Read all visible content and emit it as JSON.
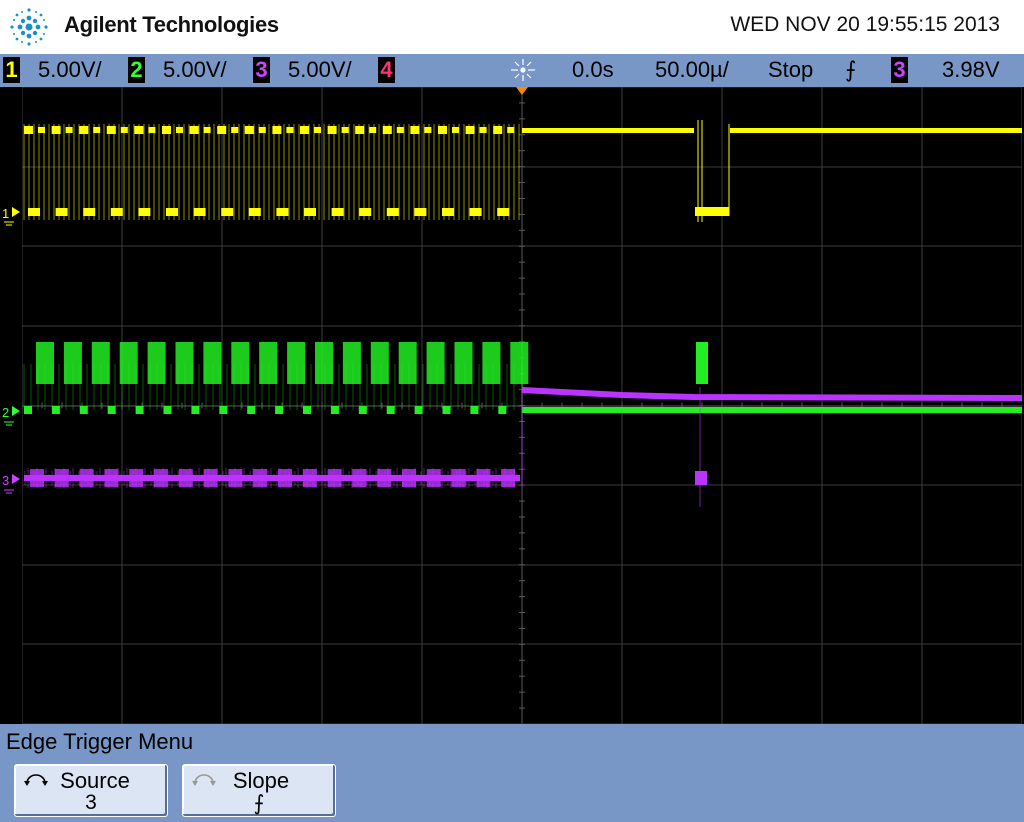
{
  "header": {
    "brand": "Agilent Technologies",
    "datetime": "WED NOV 20 19:55:15 2013"
  },
  "status_bar": {
    "channels": [
      {
        "number": "1",
        "scale": "5.00V/",
        "color": "#ffff00"
      },
      {
        "number": "2",
        "scale": "5.00V/",
        "color": "#33ff33"
      },
      {
        "number": "3",
        "scale": "5.00V/",
        "color": "#cc44ff"
      },
      {
        "number": "4",
        "scale": "",
        "color": "#ff3377"
      }
    ],
    "time_delay": "0.0s",
    "time_scale": "50.00µ/",
    "run_state": "Stop",
    "trigger_slope_symbol": "⨍",
    "trigger_source": "3",
    "trigger_level": "3.98V"
  },
  "display": {
    "markers": [
      {
        "label": "1",
        "color": "#ffff00"
      },
      {
        "label": "2",
        "color": "#33ff33"
      },
      {
        "label": "3",
        "color": "#cc44ff"
      }
    ],
    "grid": true,
    "trace_colors": {
      "ch1": "#ffff00",
      "ch2": "#22ee22",
      "ch3": "#bb33ff"
    }
  },
  "menu": {
    "title": "Edge Trigger Menu",
    "softkeys": [
      {
        "label": "Source",
        "value": "3",
        "icon": "rotary-knob-icon"
      },
      {
        "label": "Slope",
        "value": "⨍",
        "icon": "rotary-knob-icon"
      }
    ]
  }
}
